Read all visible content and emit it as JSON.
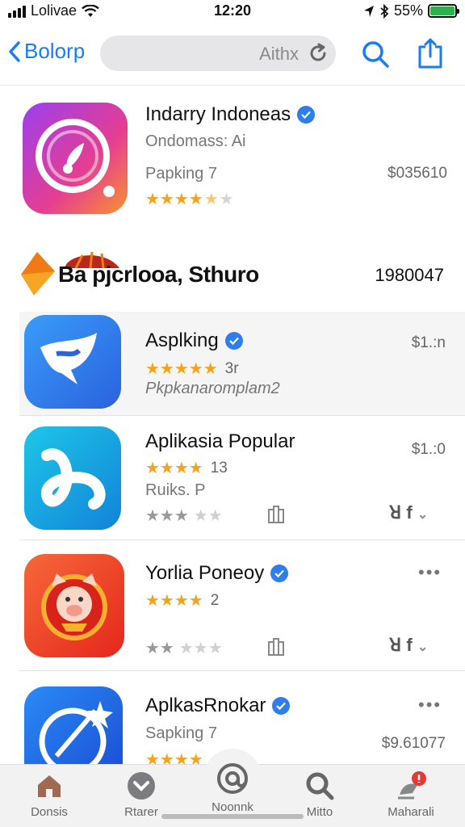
{
  "status_bar": {
    "carrier": "Lolivae",
    "time": "12:20",
    "battery": "55%",
    "battery_level": 1.0
  },
  "nav": {
    "back_label": "Bolorp",
    "search_text": "Aithx"
  },
  "apps": [
    {
      "title": "Indarry Indoneas",
      "subtitle": "Ondomass: Ai",
      "category": "Papking 7",
      "price": "$035610",
      "rating": 4.5,
      "verified": true
    },
    {
      "title": "Asplking",
      "rating_count": "3r",
      "subtitle": "Pkpkanaromplam2",
      "price": "$1.:n",
      "rating": 5,
      "verified": true
    },
    {
      "title": "Aplikasia Popular",
      "rating_count": "13",
      "subtitle": "Ruiks. P",
      "price": "$1.:0",
      "rating": 4,
      "verified": false
    },
    {
      "title": "Yorlia Poneoy",
      "rating_count": "2",
      "rating": 4,
      "verified": true
    },
    {
      "title": "AplkasRnokar",
      "subtitle": "Sapking 7",
      "price": "$9.61077",
      "rating": 4,
      "verified": true
    }
  ],
  "section": {
    "label": "Ba pjcrlooa, Sthuro",
    "number": "1980047"
  },
  "tabs": [
    {
      "label": "Donsis"
    },
    {
      "label": "Rtarer"
    },
    {
      "label": "Noonnk"
    },
    {
      "label": "Mitto"
    },
    {
      "label": "Maharali"
    }
  ],
  "colors": {
    "accent": "#1a7cf2",
    "star": "#f6a21a",
    "tab_badge": "#e53935"
  }
}
